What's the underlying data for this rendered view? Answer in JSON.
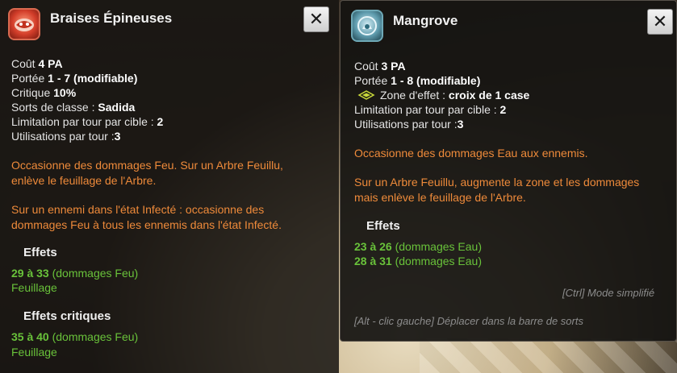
{
  "left": {
    "title": "Braises Épineuses",
    "icon": "fire-spell-icon",
    "stats": {
      "cost_label": "Coût",
      "cost_value": "4 PA",
      "range_label": "Portée",
      "range_value": "1 - 7 (modifiable)",
      "crit_label": "Critique",
      "crit_value": "10%",
      "class_label": "Sorts de classe :",
      "class_value": "Sadida",
      "limit_target_label": "Limitation par tour par cible :",
      "limit_target_value": "2",
      "uses_label": "Utilisations par tour :",
      "uses_value": "3"
    },
    "desc1_line1": "Occasionne des dommages Feu. Sur un Arbre Feuillu,",
    "desc1_line2": "enlève le feuillage de l'Arbre.",
    "desc2_line1": "Sur un ennemi dans l'état Infecté : occasionne des",
    "desc2_line2": "dommages Feu à tous les ennemis dans l'état Infecté.",
    "effects_title": "Effets",
    "effects": [
      {
        "range": "29 à 33",
        "type": "(dommages Feu)"
      },
      {
        "range": "",
        "type": "Feuillage"
      }
    ],
    "crit_effects_title": "Effets critiques",
    "crit_effects": [
      {
        "range": "35 à 40",
        "type": "(dommages Feu)"
      },
      {
        "range": "",
        "type": "Feuillage"
      }
    ]
  },
  "right": {
    "title": "Mangrove",
    "icon": "water-spell-icon",
    "stats": {
      "cost_label": "Coût",
      "cost_value": "3 PA",
      "range_label": "Portée",
      "range_value": "1 - 8 (modifiable)",
      "zone_label": "Zone d'effet :",
      "zone_value": "croix de 1 case",
      "limit_target_label": "Limitation par tour par cible :",
      "limit_target_value": "2",
      "uses_label": "Utilisations par tour :",
      "uses_value": "3"
    },
    "desc1": "Occasionne des dommages Eau aux ennemis.",
    "desc2_line1": "Sur un Arbre Feuillu, augmente la zone et les dommages",
    "desc2_line2": "mais enlève le feuillage de l'Arbre.",
    "effects_title": "Effets",
    "effects": [
      {
        "range": "23 à 26",
        "type": "(dommages Eau)"
      },
      {
        "range": "28 à 31",
        "type": "(dommages Eau)"
      }
    ],
    "hint_simplified": "[Ctrl] Mode simplifié",
    "hint_move": "[Alt - clic gauche] Déplacer dans la barre de sorts"
  },
  "close_symbol": "✕",
  "colors": {
    "description": "#ee8a3a",
    "effect_green": "#69c23a",
    "hint_gray": "#8c8c8c"
  }
}
